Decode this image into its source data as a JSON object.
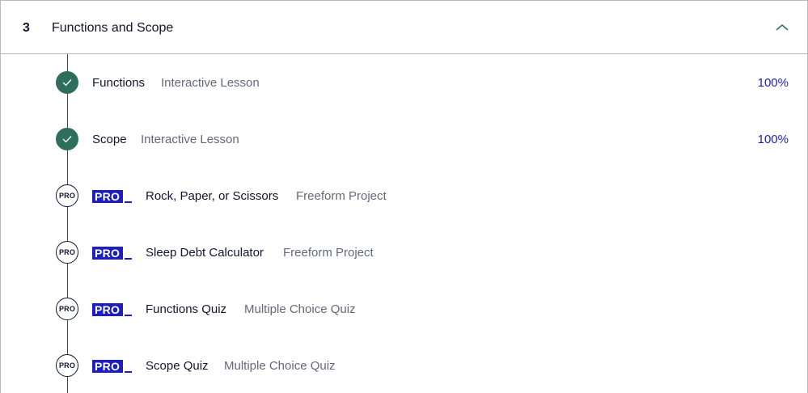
{
  "module": {
    "number": "3",
    "title": "Functions and Scope",
    "toggle_icon": "chevron-up-icon"
  },
  "colors": {
    "complete": "#2e6f5b",
    "pro_badge": "#1c1ec4",
    "progress_text": "#1c1ec4",
    "secondary_text": "#656879"
  },
  "items": [
    {
      "title": "Functions",
      "type": "Interactive Lesson",
      "progress": "100%",
      "status": "complete"
    },
    {
      "title": "Scope",
      "type": "Interactive Lesson",
      "progress": "100%",
      "status": "complete"
    },
    {
      "title": "Rock, Paper, or Scissors",
      "type": "Freeform Project",
      "status": "pro",
      "status_label": "PRO",
      "badge": "PRO"
    },
    {
      "title": "Sleep Debt Calculator",
      "type": "Freeform Project",
      "status": "pro",
      "status_label": "PRO",
      "badge": "PRO"
    },
    {
      "title": "Functions Quiz",
      "type": "Multiple Choice Quiz",
      "status": "pro",
      "status_label": "PRO",
      "badge": "PRO"
    },
    {
      "title": "Scope Quiz",
      "type": "Multiple Choice Quiz",
      "status": "pro",
      "status_label": "PRO",
      "badge": "PRO"
    }
  ]
}
